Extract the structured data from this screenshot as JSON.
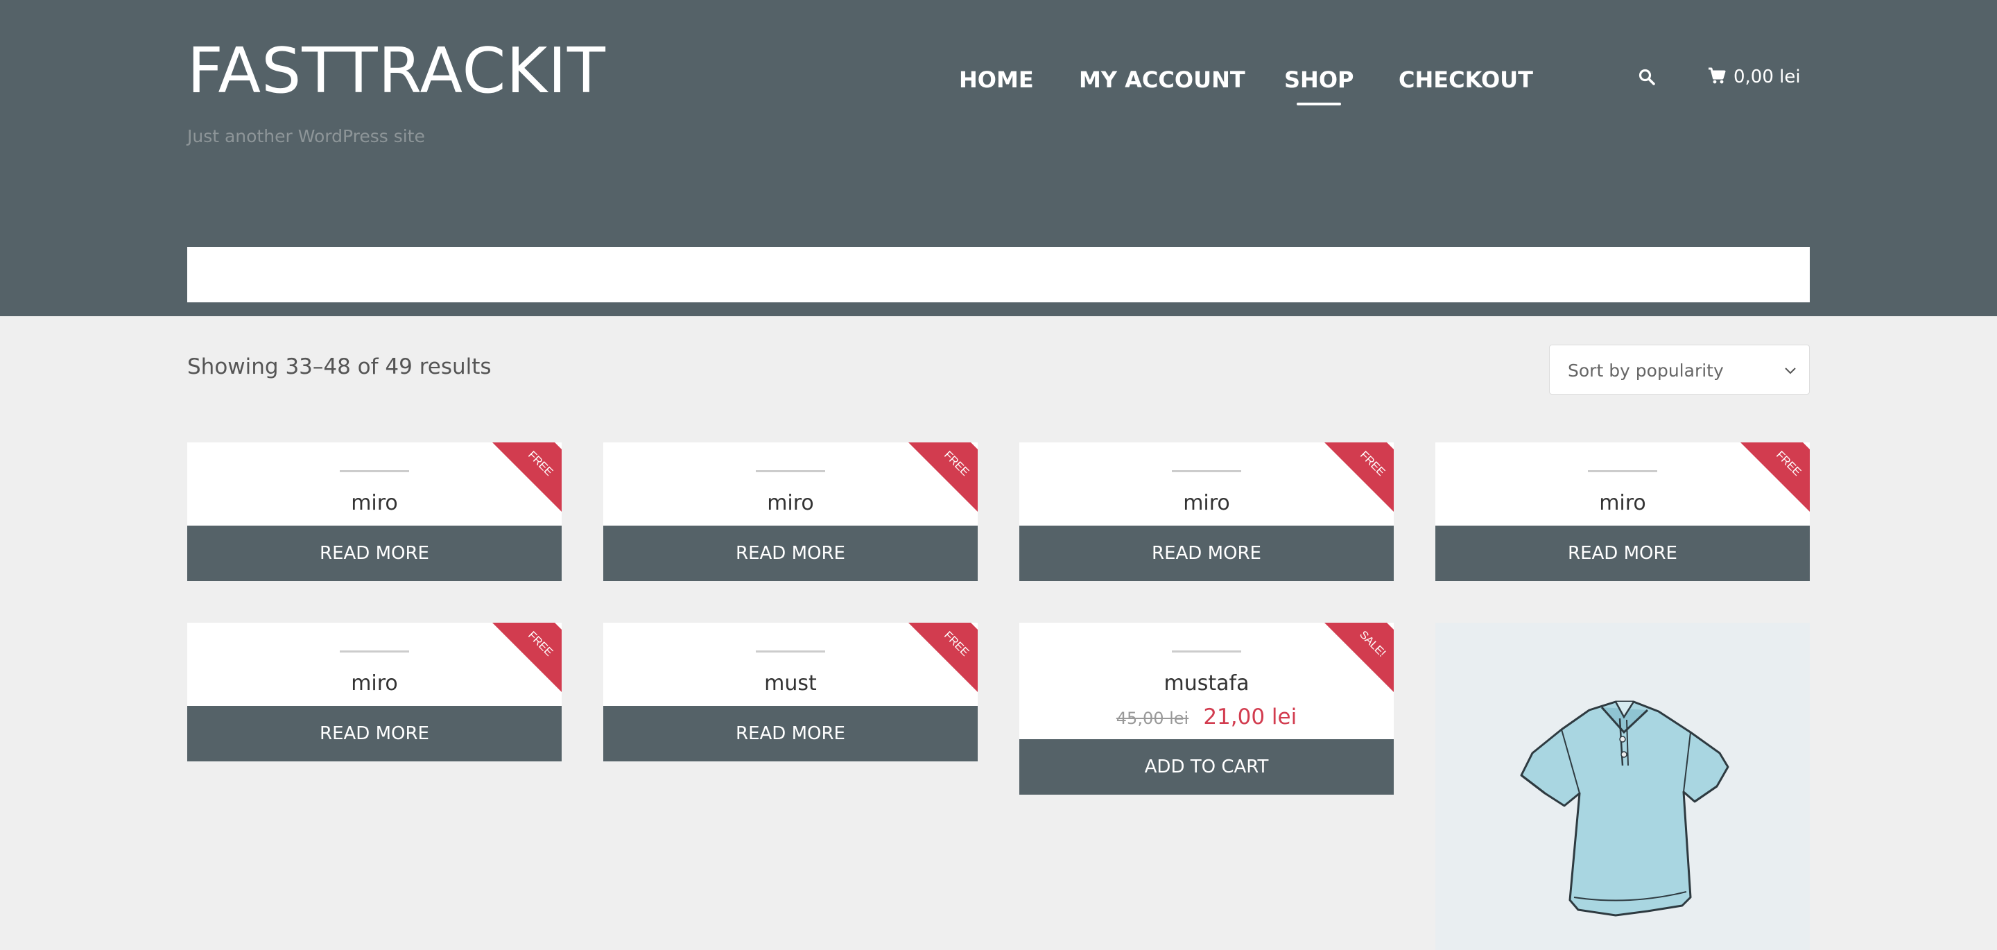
{
  "site": {
    "title": "FASTTRACKIT",
    "tagline": "Just another WordPress site"
  },
  "nav": {
    "items": [
      {
        "label": "HOME"
      },
      {
        "label": "MY ACCOUNT"
      },
      {
        "label": "SHOP",
        "active": true
      },
      {
        "label": "CHECKOUT"
      }
    ]
  },
  "header_tools": {
    "search_icon": "search-icon",
    "cart_icon": "cart-icon",
    "cart_total": "0,00 lei"
  },
  "shop": {
    "result_count": "Showing 33–48 of 49 results",
    "sort_selected": "Sort by popularity"
  },
  "products": [
    {
      "name": "miro",
      "badge": "FREE",
      "button": "READ MORE"
    },
    {
      "name": "miro",
      "badge": "FREE",
      "button": "READ MORE"
    },
    {
      "name": "miro",
      "badge": "FREE",
      "button": "READ MORE"
    },
    {
      "name": "miro",
      "badge": "FREE",
      "button": "READ MORE"
    },
    {
      "name": "miro",
      "badge": "FREE",
      "button": "READ MORE"
    },
    {
      "name": "must",
      "badge": "FREE",
      "button": "READ MORE"
    },
    {
      "name": "mustafa",
      "badge": "SALE!",
      "old_price": "45,00 lei",
      "new_price": "21,00 lei",
      "button": "ADD TO CART"
    }
  ],
  "colors": {
    "header_bg": "#556268",
    "page_bg": "#efefef",
    "badge_red": "#d23c4f",
    "button_bg": "#556268"
  }
}
